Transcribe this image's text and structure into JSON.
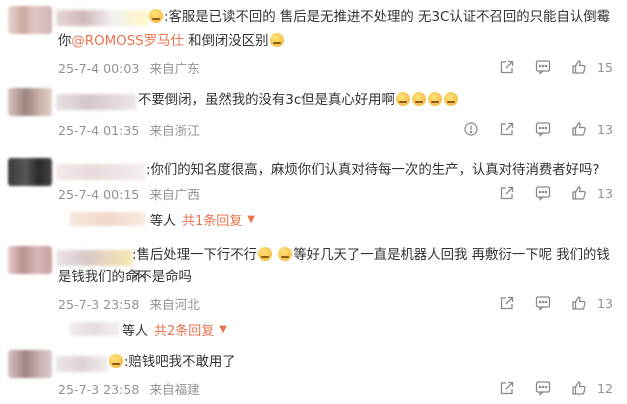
{
  "comments": [
    {
      "text_a": ":客服是已读不回的  售后是无推进不处理的  无3C认证不召回的只能自认倒霉",
      "text_b_pre": "你",
      "mention": "@ROMOSS罗马仕",
      "text_b_post": " 和倒闭没区别",
      "date": "25-7-4 00:03",
      "location": "来自广东",
      "likes": "15"
    },
    {
      "text_a": "不要倒闭，虽然我的没有3c但是真心好用啊",
      "date": "25-7-4 01:35",
      "location": "来自浙江",
      "likes": "13"
    },
    {
      "text_a": ":你们的知名度很高，麻烦你们认真对待每一次的生产，认真对待消费者好吗?",
      "date": "25-7-4 00:15",
      "location": "来自广西",
      "likes": "13",
      "reply_prefix": "等人",
      "reply_link": "共1条回复"
    },
    {
      "text_a": ":售后处理一下行不行",
      "text_a2": "等好几天了一直是机器人回我 再敷衍一下呢 我们的钱不",
      "text_b": "是钱我们的命不是命吗",
      "date": "25-7-3 23:58",
      "location": "来自河北",
      "likes": "13",
      "reply_prefix": "等人",
      "reply_link": "共2条回复"
    },
    {
      "text_a": ":赔钱吧我不敢用了",
      "date": "25-7-3 23:58",
      "location": "来自福建",
      "likes": "12"
    }
  ],
  "icons": [
    "share-icon",
    "comment-icon",
    "like-icon",
    "report-icon"
  ],
  "colors": {
    "accent": "#eb7350",
    "meta": "#939393"
  }
}
